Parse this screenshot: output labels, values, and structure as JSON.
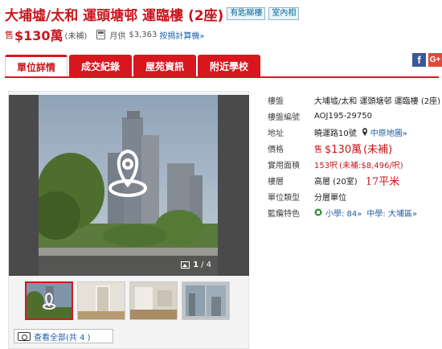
{
  "header": {
    "title": "大埔墟/太和 運頭塘邨 運臨樓 (2座)",
    "tags": [
      "有匙睇樓",
      "室內相"
    ]
  },
  "price": {
    "prefix": "售",
    "amount": "$130萬",
    "note": "(未補)",
    "monthly_label": "月供",
    "monthly_value": "$3,363",
    "calc_link": "按揭計算機»"
  },
  "tabs": [
    {
      "label": "單位詳情",
      "active": true
    },
    {
      "label": "成交紀錄",
      "active": false
    },
    {
      "label": "屋苑資訊",
      "active": false
    },
    {
      "label": "附近學校",
      "active": false
    }
  ],
  "social": {
    "facebook": "f",
    "google_plus": "G+"
  },
  "gallery": {
    "counter_current": "1",
    "counter_total": "/ 4",
    "view_all": "查看全部(共 4 )",
    "thumbnail_count": 4
  },
  "details": {
    "estate_label": "樓盤",
    "estate_value": "大埔墟/太和 運頭塘邨 運臨樓 (2座)",
    "code_label": "樓盤編號",
    "code_value": "AOJ195-29750",
    "address_label": "地址",
    "address_value": "曉運路10號",
    "map_link": "中原地圖»",
    "price_label": "價格",
    "price_prefix": "售",
    "price_amount": "$130萬",
    "price_note": "(未補)",
    "area_label": "實用面積",
    "area_value": "153呎",
    "area_note": "(未補:$8,496/呎)",
    "floor_label": "樓層",
    "floor_value": "高層 (20室)",
    "handwritten_note": "17平米",
    "type_label": "單位類型",
    "type_value": "分層單位",
    "feature_label": "籃纜特色",
    "primary_school": "小學: 84»",
    "secondary_school": "中學: 大埔區»"
  },
  "colors": {
    "brand_red": "#d7161e",
    "link_blue": "#1e5fa8",
    "tag_blue": "#0a6a9a"
  }
}
